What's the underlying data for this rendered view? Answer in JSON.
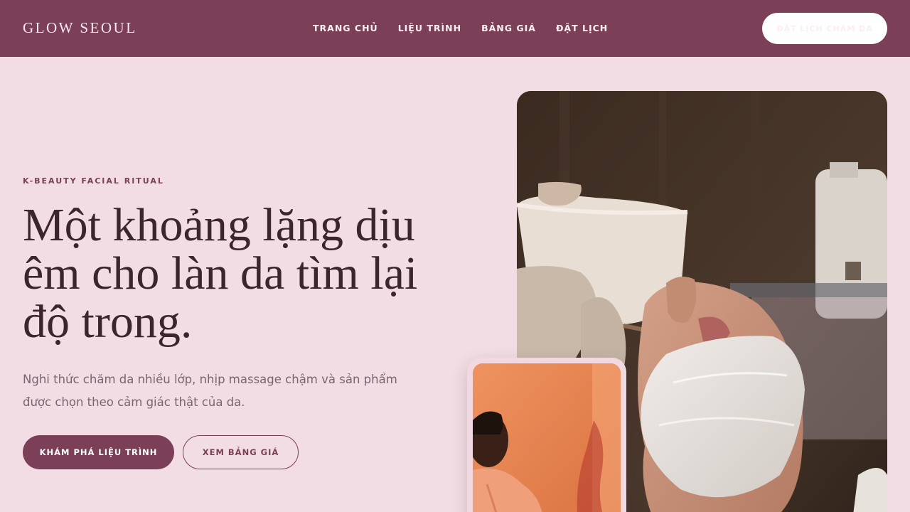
{
  "brand": {
    "logo": "GLOW SEOUL"
  },
  "nav": {
    "items": [
      "TRANG CHỦ",
      "LIỆU TRÌNH",
      "BẢNG GIÁ",
      "ĐẶT LỊCH"
    ],
    "cta_label": "ĐẶT LỊCH CHĂM DA"
  },
  "hero": {
    "eyebrow": "K-BEAUTY FACIAL RITUAL",
    "headline": "Một khoảng lặng dịu êm cho làn da tìm lại độ trong.",
    "lede": "Nghi thức chăm da nhiều lớp, nhịp massage chậm và sản phẩm được chọn theo cảm giác thật của da.",
    "primary_button": "KHÁM PHÁ LIỆU TRÌNH",
    "secondary_button": "XEM BẢNG GIÁ"
  },
  "colors": {
    "header_bg": "#7b3f58",
    "page_bg": "#f1dde3",
    "accent": "#7b3f58",
    "heading_text": "#3d2530"
  }
}
